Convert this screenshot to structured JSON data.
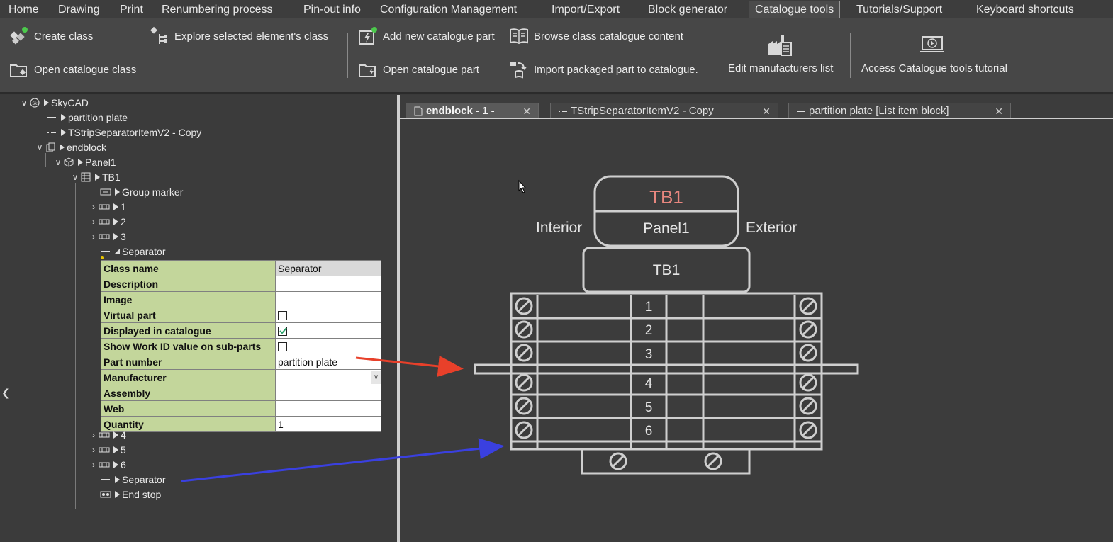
{
  "menu": {
    "tabs": [
      "Home",
      "Drawing",
      "Print",
      "Renumbering process",
      "Pin-out info",
      "Configuration Management",
      "Import/Export",
      "Block generator",
      "Catalogue tools",
      "Tutorials/Support",
      "Keyboard shortcuts"
    ],
    "active": "Catalogue tools"
  },
  "ribbon": {
    "create_class": "Create class",
    "open_class": "Open catalogue class",
    "explore_class": "Explore selected element's class",
    "add_part": "Add new catalogue part",
    "open_part": "Open catalogue part",
    "browse_content": "Browse class catalogue content",
    "import_part": "Import packaged part to catalogue.",
    "edit_manufacturers": "Edit manufacturers list",
    "tutorial": "Access Catalogue tools tutorial"
  },
  "tree": {
    "root": "SkyCAD",
    "partition_plate": "partition plate",
    "tstrip": "TStripSeparatorItemV2 - Copy",
    "endblock": "endblock",
    "panel": "Panel1",
    "tb": "TB1",
    "group_marker": "Group marker",
    "items": [
      "1",
      "2",
      "3",
      "4",
      "5",
      "6"
    ],
    "separator": "Separator",
    "separator2": "Separator",
    "end_stop": "End stop"
  },
  "properties": [
    {
      "name": "Class name",
      "value": "Separator",
      "readonly": true
    },
    {
      "name": "Description",
      "value": ""
    },
    {
      "name": "Image",
      "value": ""
    },
    {
      "name": "Virtual part",
      "checkbox": false
    },
    {
      "name": "Displayed in catalogue",
      "checkbox": true
    },
    {
      "name": "Show Work ID value on sub-parts",
      "checkbox": false
    },
    {
      "name": "Part number",
      "value": "partition plate"
    },
    {
      "name": "Manufacturer",
      "value": "",
      "dropdown": true
    },
    {
      "name": "Assembly",
      "value": ""
    },
    {
      "name": "Web",
      "value": ""
    },
    {
      "name": "Quantity",
      "value": "1"
    }
  ],
  "doc_tabs": [
    {
      "label": "endblock - 1 -",
      "active": true
    },
    {
      "label": "TStripSeparatorItemV2 - Copy",
      "active": false
    },
    {
      "label": "partition plate [List item block]",
      "active": false
    }
  ],
  "drawing": {
    "tb_title": "TB1",
    "panel": "Panel1",
    "interior": "Interior",
    "exterior": "Exterior",
    "tb_box": "TB1",
    "rows": [
      "1",
      "2",
      "3",
      "4",
      "5",
      "6"
    ]
  },
  "colors": {
    "accent_red": "#e8877f",
    "arrow_red": "#e8402a",
    "arrow_blue": "#3a40e0",
    "prop_label_bg": "#c3d69b"
  }
}
